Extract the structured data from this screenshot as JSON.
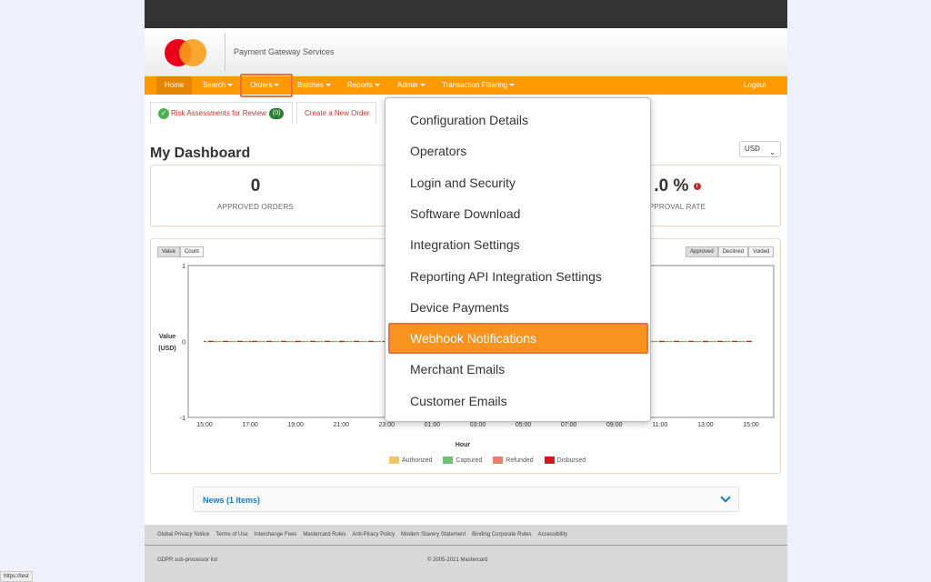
{
  "header": {
    "brand": "Payment Gateway Services"
  },
  "nav": {
    "home": "Home",
    "search": "Search",
    "orders": "Orders",
    "batches": "Batches",
    "reports": "Reports",
    "admin": "Admin",
    "transaction_filtering": "Transaction Filtering",
    "logout": "Logout"
  },
  "subtabs": {
    "risk": "Risk Assessments for Review",
    "risk_count": "(0)",
    "create_order": "Create a New Order"
  },
  "dashboard": {
    "title": "My Dashboard",
    "currency": "USD",
    "stats": [
      {
        "value": "0",
        "label": "APPROVED ORDERS"
      },
      {
        "value": ".0 %",
        "label": "PPROVAL RATE"
      }
    ]
  },
  "chart_controls": {
    "value_btn": "Value",
    "count_btn": "Count",
    "approved_btn": "Approved",
    "declined_btn": "Declined",
    "voided_btn": "Voided"
  },
  "chart_data": {
    "type": "line",
    "ylabel": [
      "Value",
      "(USD)"
    ],
    "xlabel": "Hour",
    "ylim": [
      -1,
      1
    ],
    "yticks": [
      "1",
      "0",
      "-1"
    ],
    "categories": [
      "15:00",
      "17:00",
      "19:00",
      "21:00",
      "23:00",
      "01:00",
      "03:00",
      "05:00",
      "07:00",
      "09:00",
      "11:00",
      "13:00",
      "15:00"
    ],
    "series": [
      {
        "name": "Authorized",
        "color": "#f2c46d",
        "values": [
          0,
          0,
          0,
          0,
          0,
          0,
          0,
          0,
          0,
          0,
          0,
          0,
          0
        ]
      },
      {
        "name": "Captured",
        "color": "#6cc46c",
        "values": [
          0,
          0,
          0,
          0,
          0,
          0,
          0,
          0,
          0,
          0,
          0,
          0,
          0
        ]
      },
      {
        "name": "Refunded",
        "color": "#e8826a",
        "values": [
          0,
          0,
          0,
          0,
          0,
          0,
          0,
          0,
          0,
          0,
          0,
          0,
          0
        ]
      },
      {
        "name": "Disbursed",
        "color": "#d0191a",
        "values": [
          0,
          0,
          0,
          0,
          0,
          0,
          0,
          0,
          0,
          0,
          0,
          0,
          0
        ]
      }
    ]
  },
  "news": {
    "title": "News (1 Items)"
  },
  "footer": {
    "links": [
      "Global Privacy Notice",
      "Terms of Use",
      "Interchange Fees",
      "Mastercard Rules",
      "Anti-Piracy Policy",
      "Modern Slavery Statement",
      "Binding Corporate Rules",
      "Accessibility"
    ],
    "subprocessor": "GDPR sub-processor list",
    "copyright": "© 2005-2021 Mastercard"
  },
  "admin_menu": {
    "items": [
      "Configuration Details",
      "Operators",
      "Login and Security",
      "Software Download",
      "Integration Settings",
      "Reporting API Integration Settings",
      "Device Payments",
      "Webhook Notifications",
      "Merchant Emails",
      "Customer Emails"
    ],
    "active_index": 7
  },
  "status_url": "https://test"
}
